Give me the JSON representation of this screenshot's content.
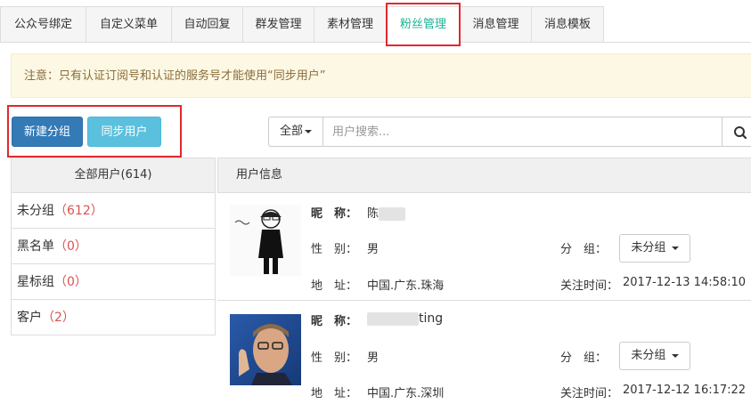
{
  "tabs": [
    {
      "label": "公众号绑定"
    },
    {
      "label": "自定义菜单"
    },
    {
      "label": "自动回复"
    },
    {
      "label": "群发管理"
    },
    {
      "label": "素材管理"
    },
    {
      "label": "粉丝管理"
    },
    {
      "label": "消息管理"
    },
    {
      "label": "消息模板"
    }
  ],
  "notice": "注意：只有认证订阅号和认证的服务号才能使用“同步用户”",
  "buttons": {
    "new_group": "新建分组",
    "sync_users": "同步用户"
  },
  "search": {
    "filter": "全部",
    "placeholder": "用户搜索..."
  },
  "groups": {
    "header": "全部用户(614)",
    "items": [
      {
        "name": "未分组",
        "count": "612"
      },
      {
        "name": "黑名单",
        "count": "0"
      },
      {
        "name": "星标组",
        "count": "0"
      },
      {
        "name": "客户",
        "count": "2"
      }
    ]
  },
  "user_panel": {
    "header": "用户信息",
    "labels": {
      "nickname": "昵　称：",
      "gender": "性　别：",
      "address": "地　址：",
      "group": "分　组：",
      "follow_time": "关注时间："
    },
    "users": [
      {
        "nickname": "陈",
        "gender": "男",
        "address": "中国.广东.珠海",
        "group": "未分组",
        "follow_time": "2017-12-13 14:58:10"
      },
      {
        "nickname": "ting",
        "gender": "男",
        "address": "中国.广东.深圳",
        "group": "未分组",
        "follow_time": "2017-12-12 16:17:22"
      }
    ]
  },
  "colors": {
    "primary": "#337ab7",
    "info": "#5bc0de",
    "active_tab": "#1ab394",
    "highlight": "#e0282f",
    "count": "#d9534f"
  }
}
